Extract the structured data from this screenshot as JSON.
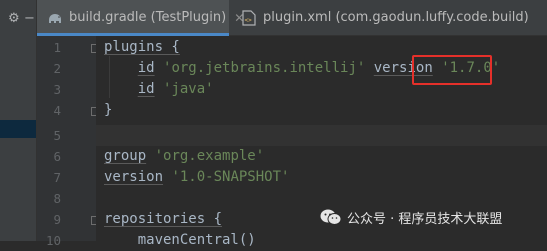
{
  "left_strip": {
    "icons": [
      "settings-icon",
      "minimize-icon"
    ]
  },
  "tabs": [
    {
      "title": "build.gradle (TestPlugin)",
      "icon": "gradle-elephant-icon",
      "active": true
    },
    {
      "title": "plugin.xml (com.gaodun.luffy.code.build)",
      "icon": "xml-file-icon",
      "active": false
    }
  ],
  "lines": [
    {
      "number": "1",
      "text": "plugins {"
    },
    {
      "number": "2",
      "keyword": "id",
      "value": "'org.jetbrains.intellij'",
      "keyword2": "version",
      "value2": "'1.7.0'"
    },
    {
      "number": "3",
      "keyword": "id",
      "value": "'java'"
    },
    {
      "number": "4",
      "text": "}"
    },
    {
      "number": "5",
      "text": ""
    },
    {
      "number": "6",
      "keyword": "group",
      "value": "'org.example'"
    },
    {
      "number": "7",
      "keyword": "version",
      "value": "'1.0-SNAPSHOT'"
    },
    {
      "number": "8",
      "text": ""
    },
    {
      "number": "9",
      "text": "repositories {"
    },
    {
      "number": "10",
      "text": "mavenCentral()"
    }
  ],
  "highlight": {
    "value": "'1.7.0'",
    "color": "#e5302a"
  },
  "watermark": {
    "text": "公众号 · 程序员技术大联盟"
  },
  "colors": {
    "background": "#2b2b2b",
    "keyword": "#cc7832",
    "string": "#6a8759",
    "identifier": "#a9b7c6",
    "tab_accent": "#4a88c7"
  }
}
